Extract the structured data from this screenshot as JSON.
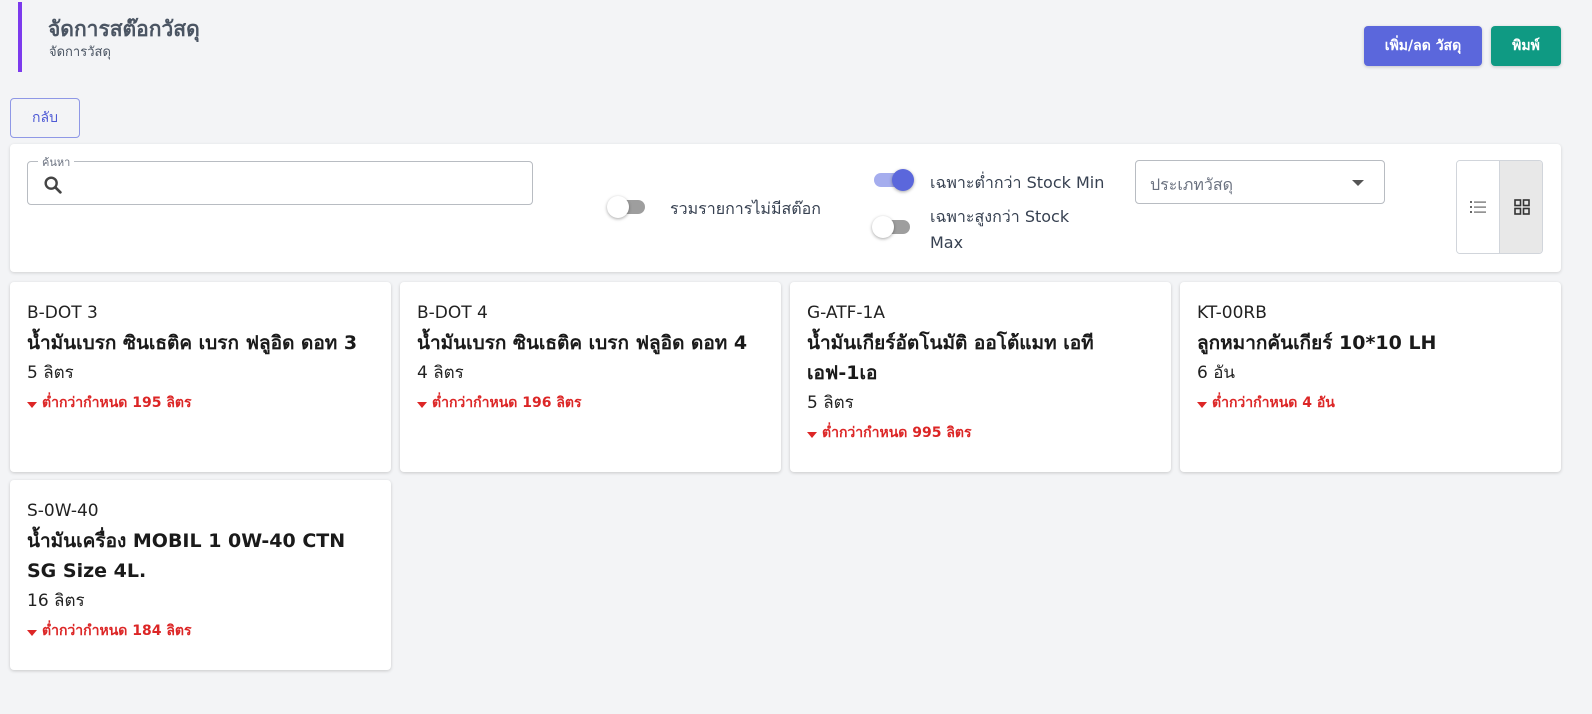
{
  "header": {
    "title": "จัดการสต๊อกวัสดุ",
    "subtitle": "จัดการวัสดุ",
    "accent_color": "#7c3aed"
  },
  "actions": {
    "adjust_label": "เพิ่ม/ลด วัสดุ",
    "print_label": "พิมพ์",
    "back_label": "กลับ"
  },
  "filters": {
    "search_label": "ค้นหา",
    "search_value": "",
    "include_no_stock_label": "รวมรายการไม่มีสต๊อก",
    "include_no_stock_on": false,
    "below_min_label": "เฉพาะต่ำกว่า Stock Min",
    "below_min_on": true,
    "above_max_label": "เฉพาะสูงกว่า Stock Max",
    "above_max_on": false,
    "type_placeholder": "ประเภทวัสดุ",
    "view_mode": "grid"
  },
  "items": [
    {
      "code": "B-DOT 3",
      "name": "น้ำมันเบรก ซินเธติค เบรก ฟลูอิด ดอท 3",
      "qty": "5 ลิตร",
      "alert": "ต่ำกว่ากำหนด 195 ลิตร"
    },
    {
      "code": "B-DOT 4",
      "name": "น้ำมันเบรก ซินเธติค เบรก ฟลูอิด ดอท 4",
      "qty": "4 ลิตร",
      "alert": "ต่ำกว่ากำหนด 196 ลิตร"
    },
    {
      "code": "G-ATF-1A",
      "name": "น้ำมันเกียร์อัตโนมัติ ออโต้แมท เอทีเอฟ-1เอ",
      "qty": "5 ลิตร",
      "alert": "ต่ำกว่ากำหนด 995 ลิตร"
    },
    {
      "code": "KT-00RB",
      "name": "ลูกหมากคันเกียร์ 10*10 LH",
      "qty": "6 อัน",
      "alert": "ต่ำกว่ากำหนด 4 อัน"
    },
    {
      "code": "S-0W-40",
      "name": "น้ำมันเครื่อง MOBIL 1 0W-40 CTN SG Size 4L.",
      "qty": "16 ลิตร",
      "alert": "ต่ำกว่ากำหนด 184 ลิตร"
    }
  ],
  "colors": {
    "primary": "#5b67dc",
    "print": "#0f9a83",
    "alert": "#dc2626"
  }
}
